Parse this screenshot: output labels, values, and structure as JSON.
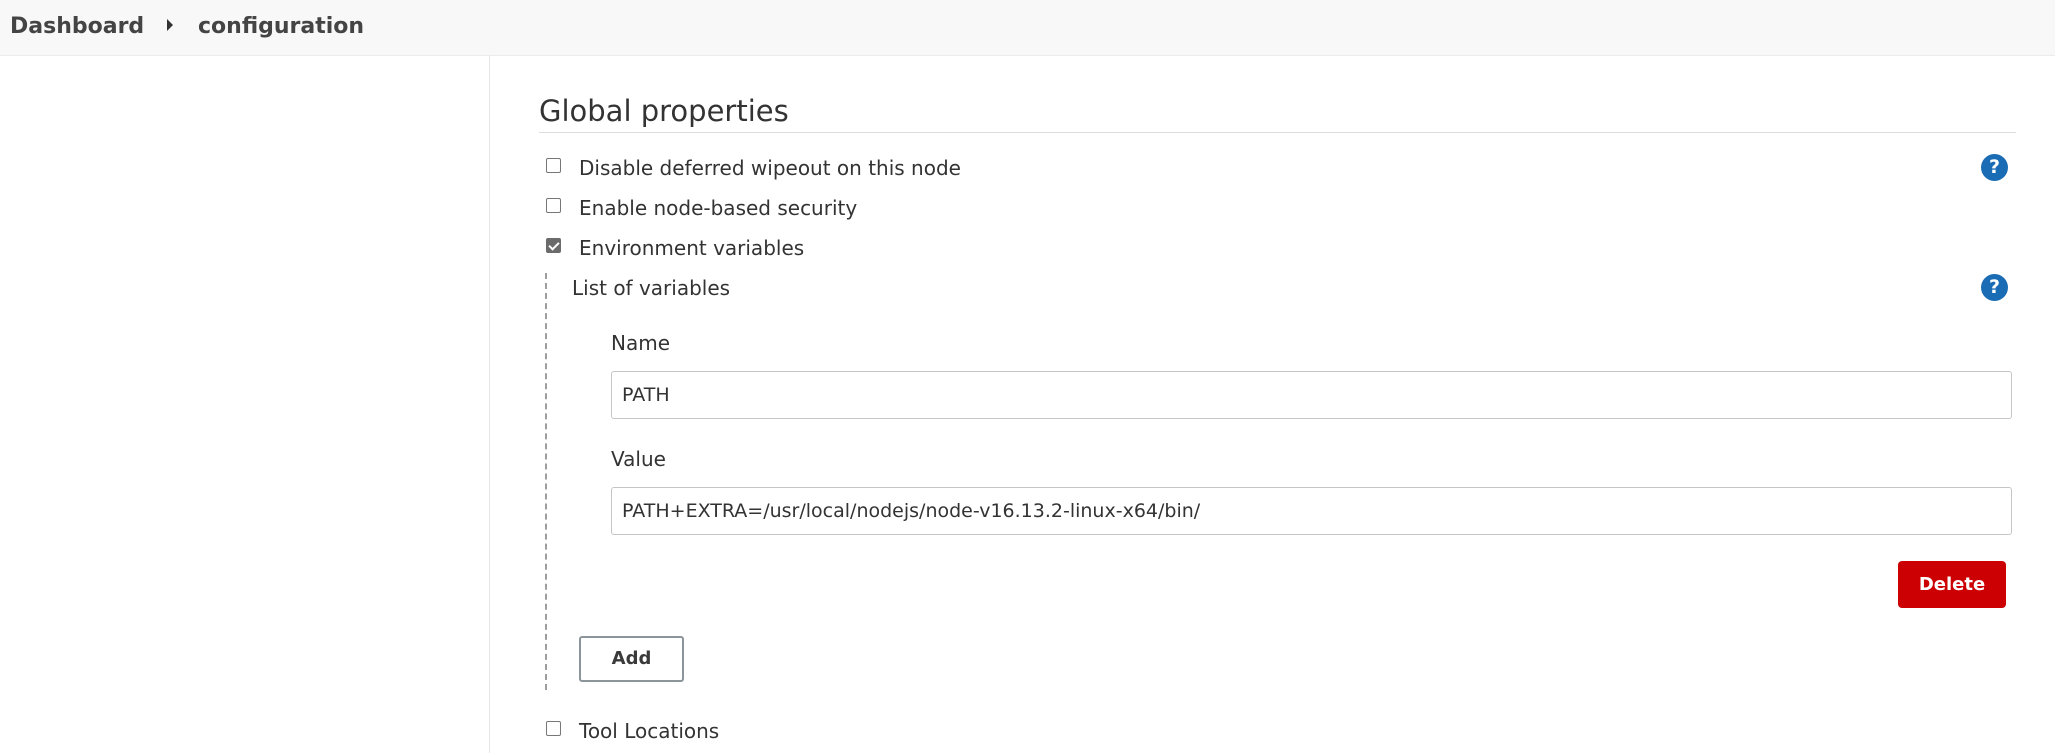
{
  "breadcrumb": {
    "items": [
      "Dashboard",
      "configuration"
    ]
  },
  "section": {
    "title": "Global properties"
  },
  "options": [
    {
      "label": "Disable deferred wipeout on this node",
      "checked": false
    },
    {
      "label": "Enable node-based security",
      "checked": false
    },
    {
      "label": "Environment variables",
      "checked": true
    },
    {
      "label": "Tool Locations",
      "checked": false
    }
  ],
  "env_vars": {
    "list_label": "List of variables",
    "name_label": "Name",
    "name_value": "PATH",
    "value_label": "Value",
    "value_value": "PATH+EXTRA=/usr/local/nodejs/node-v16.13.2-linux-x64/bin/",
    "delete_label": "Delete",
    "add_label": "Add"
  },
  "help_glyph": "?",
  "colors": {
    "help_blue": "#1a6db5",
    "delete_red": "#cc0003"
  }
}
